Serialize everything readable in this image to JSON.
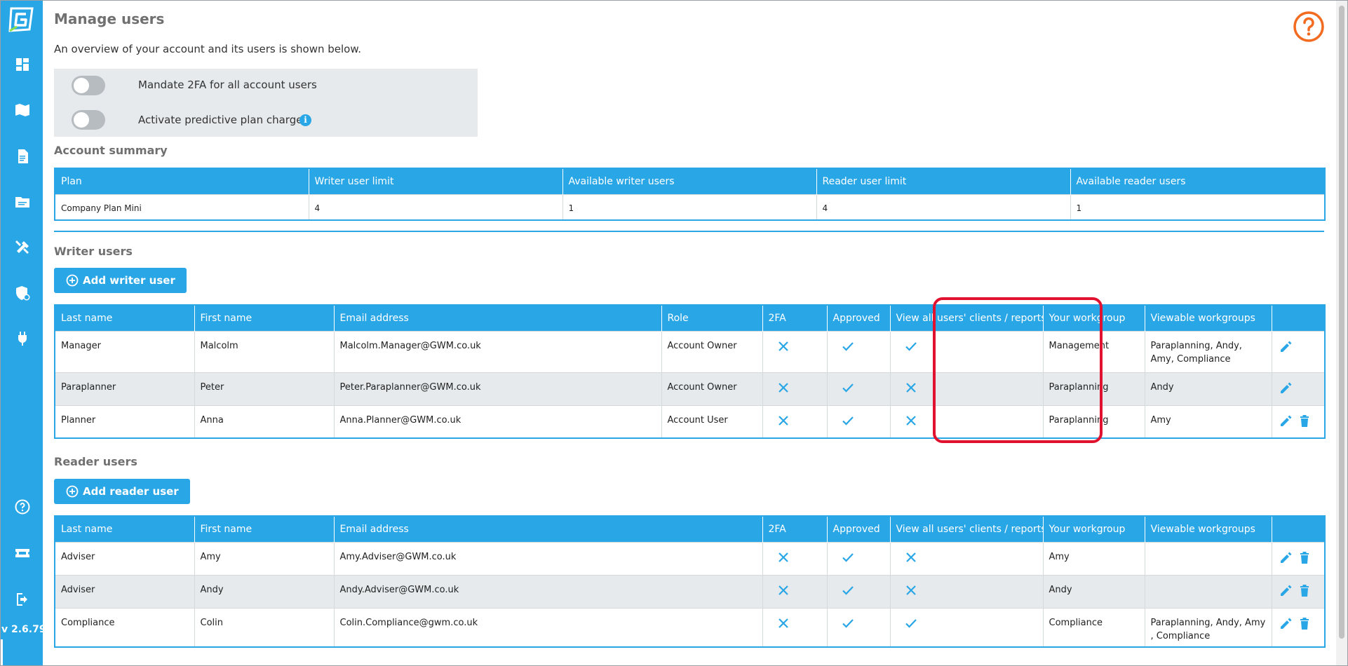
{
  "app": {
    "version": "v 2.6.79",
    "accent_color": "#29a6e6",
    "help_color": "#f26b21",
    "highlight_color": "#e0122f"
  },
  "sidebar": {
    "items": [
      {
        "icon": "dashboard-icon"
      },
      {
        "icon": "book-map-icon"
      },
      {
        "icon": "document-icon"
      },
      {
        "icon": "folder-icon"
      },
      {
        "icon": "tools-icon"
      },
      {
        "icon": "shield-user-icon"
      },
      {
        "icon": "plug-icon"
      },
      {
        "icon": "help-circle-icon"
      },
      {
        "icon": "ticket-icon"
      },
      {
        "icon": "logout-icon"
      }
    ]
  },
  "page": {
    "title": "Manage users",
    "intro": "An overview of your account and its users is shown below.",
    "toggles": [
      {
        "label": "Mandate 2FA for all account users",
        "on": false
      },
      {
        "label": "Activate predictive plan charges",
        "on": false,
        "info": "i"
      }
    ]
  },
  "account_summary": {
    "title": "Account summary",
    "headers": [
      "Plan",
      "Writer user limit",
      "Available writer users",
      "Reader user limit",
      "Available reader users"
    ],
    "row": [
      "Company Plan Mini",
      "4",
      "1",
      "4",
      "1"
    ]
  },
  "writer_users": {
    "title": "Writer users",
    "add_button": "Add writer user",
    "headers": [
      "Last name",
      "First name",
      "Email address",
      "Role",
      "2FA",
      "Approved",
      "View all users' clients / reports",
      "Your workgroup",
      "Viewable workgroups",
      ""
    ],
    "rows": [
      {
        "last": "Manager",
        "first": "Malcolm",
        "email": "Malcolm.Manager@GWM.co.uk",
        "role": "Account Owner",
        "twofa": "cross",
        "approved": "check",
        "view_all": "check",
        "workgroup": "Management",
        "viewable": "Paraplanning, Andy, Amy, Compliance",
        "delete": false
      },
      {
        "last": "Paraplanner",
        "first": "Peter",
        "email": "Peter.Paraplanner@GWM.co.uk",
        "role": "Account Owner",
        "twofa": "cross",
        "approved": "check",
        "view_all": "cross",
        "workgroup": "Paraplanning",
        "viewable": "Andy",
        "delete": false
      },
      {
        "last": "Planner",
        "first": "Anna",
        "email": "Anna.Planner@GWM.co.uk",
        "role": "Account User",
        "twofa": "cross",
        "approved": "check",
        "view_all": "cross",
        "workgroup": "Paraplanning",
        "viewable": "Amy",
        "delete": true
      }
    ]
  },
  "reader_users": {
    "title": "Reader users",
    "add_button": "Add reader user",
    "headers": [
      "Last name",
      "First name",
      "Email address",
      "2FA",
      "Approved",
      "View all users' clients / reports",
      "Your workgroup",
      "Viewable workgroups",
      ""
    ],
    "rows": [
      {
        "last": "Adviser",
        "first": "Amy",
        "email": "Amy.Adviser@GWM.co.uk",
        "twofa": "cross",
        "approved": "check",
        "view_all": "cross",
        "workgroup": "Amy",
        "viewable": "",
        "delete": true
      },
      {
        "last": "Adviser",
        "first": "Andy",
        "email": "Andy.Adviser@GWM.co.uk",
        "twofa": "cross",
        "approved": "check",
        "view_all": "cross",
        "workgroup": "Andy",
        "viewable": "",
        "delete": true
      },
      {
        "last": "Compliance",
        "first": "Colin",
        "email": "Colin.Compliance@gwm.co.uk",
        "twofa": "cross",
        "approved": "check",
        "view_all": "check",
        "workgroup": "Compliance",
        "viewable": "Paraplanning, Andy, Amy , Compliance",
        "delete": true
      }
    ]
  }
}
